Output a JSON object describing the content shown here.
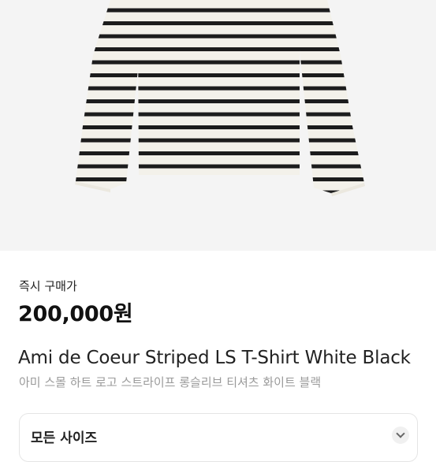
{
  "product": {
    "image_alt": "striped-long-sleeve-shirt-photo",
    "price_label": "즉시 구매가",
    "price": "200,000원",
    "name_en": "Ami de Coeur Striped LS T-Shirt White Black",
    "name_ko": "아미 스몰 하트 로고 스트라이프 롱슬리브 티셔츠 화이트 블랙"
  },
  "size_selector": {
    "label": "모든 사이즈"
  },
  "colors": {
    "background": "#f4f4f4",
    "shirt": "#f3f1ea",
    "stripe": "#1c1c1c"
  }
}
